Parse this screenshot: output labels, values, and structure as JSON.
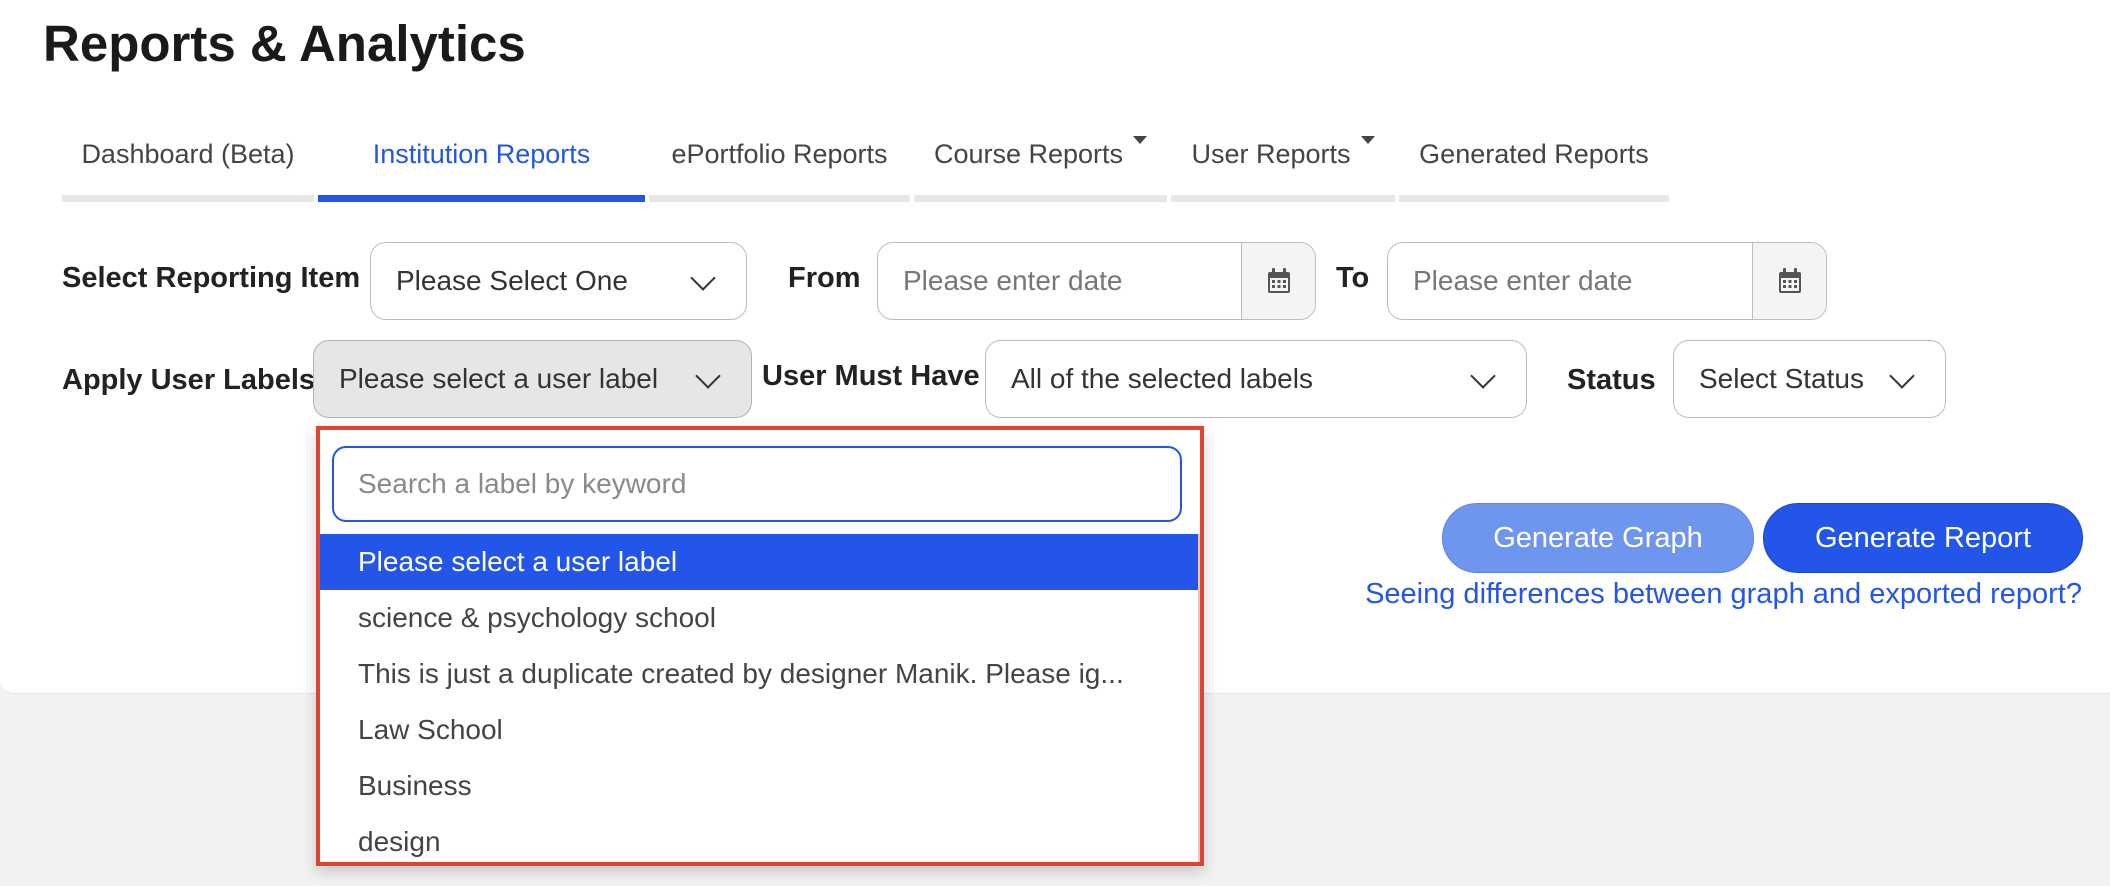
{
  "page": {
    "title": "Reports & Analytics"
  },
  "tabs": [
    {
      "label": "Dashboard (Beta)",
      "active": false,
      "has_menu": false
    },
    {
      "label": "Institution Reports",
      "active": true,
      "has_menu": false
    },
    {
      "label": "ePortfolio Reports",
      "active": false,
      "has_menu": false
    },
    {
      "label": "Course Reports",
      "active": false,
      "has_menu": true
    },
    {
      "label": "User Reports",
      "active": false,
      "has_menu": true
    },
    {
      "label": "Generated Reports",
      "active": false,
      "has_menu": false
    }
  ],
  "filters": {
    "reporting_item": {
      "label": "Select Reporting Item",
      "value": "Please Select One"
    },
    "from": {
      "label": "From",
      "placeholder": "Please enter date"
    },
    "to": {
      "label": "To",
      "placeholder": "Please enter date"
    },
    "user_labels": {
      "label": "Apply User Labels",
      "value": "Please select a user label"
    },
    "user_must_have": {
      "label": "User Must Have",
      "value": "All of the selected labels"
    },
    "status": {
      "label": "Status",
      "value": "Select Status"
    }
  },
  "actions": {
    "generate_graph": "Generate Graph",
    "generate_report": "Generate Report",
    "help_link": "Seeing differences between graph and exported report?"
  },
  "label_dropdown": {
    "search_placeholder": "Search a label by keyword",
    "options": [
      {
        "label": "Please select a user label",
        "selected": true
      },
      {
        "label": "science & psychology school",
        "selected": false
      },
      {
        "label": "This is just a duplicate created by designer Manik. Please ig...",
        "selected": false
      },
      {
        "label": "Law School",
        "selected": false
      },
      {
        "label": "Business",
        "selected": false
      },
      {
        "label": "design",
        "selected": false
      }
    ]
  },
  "colors": {
    "accent": "#2356e8",
    "accent_light": "#6f96ef",
    "highlight_border": "#e0432f"
  },
  "icons": {
    "calendar": "calendar-icon",
    "chevron": "chevron-down-icon",
    "caret": "caret-down-icon"
  }
}
